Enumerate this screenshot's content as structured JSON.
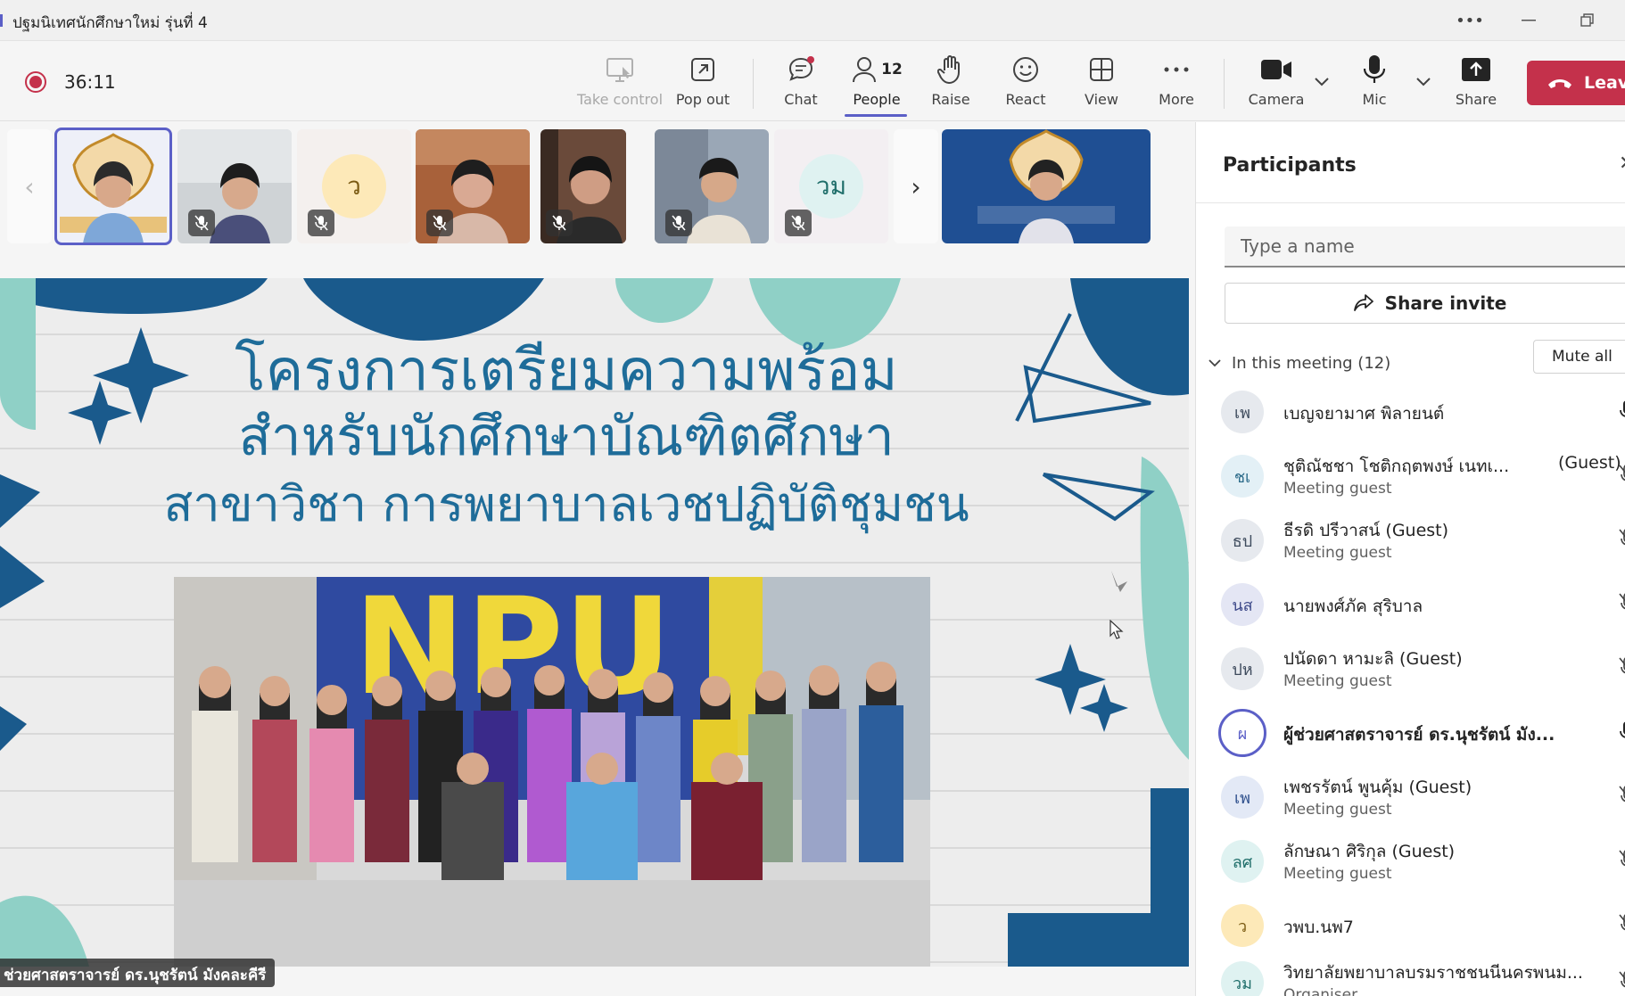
{
  "window": {
    "title": "ปฐมนิเทศนักศึกษาใหม่ รุ่นที่ 4"
  },
  "toolbar": {
    "timer": "36:11",
    "take_control": "Take control",
    "pop_out": "Pop out",
    "chat": "Chat",
    "people": "People",
    "people_count": "12",
    "raise": "Raise",
    "react": "React",
    "view": "View",
    "more": "More",
    "camera": "Camera",
    "mic": "Mic",
    "share": "Share",
    "leave": "Leave"
  },
  "strip": {
    "avatar_initials": [
      "ว",
      "วม"
    ]
  },
  "slide": {
    "line1": "โครงการเตรียมความพร้อม",
    "line2": "สำหรับนักศึกษาบัณฑิตศึกษา",
    "line3": "สาขาวิชา การพยาบาลเวชปฏิบัติชุมชน",
    "photo_banner_text": "NPU",
    "speaker_tag": "ช่วยศาสตราจารย์ ดร.นุชรัตน์ มังคละคีรี"
  },
  "panel": {
    "title": "Participants",
    "search_placeholder": "Type a name",
    "share_invite": "Share invite",
    "section_label": "In this meeting (12)",
    "mute_all": "Mute all",
    "participants": [
      {
        "initials": "เพ",
        "name": "เบญจยามาศ พิลายนต์",
        "sub": "",
        "guest_tag": ""
      },
      {
        "initials": "ชเ",
        "name": "ชุติณัชชา โชติกฤตพงษ์ เนทเ...",
        "sub": "Meeting guest",
        "guest_tag": "(Guest)"
      },
      {
        "initials": "ธป",
        "name": "ธีรดิ ปรีวาสน์ (Guest)",
        "sub": "Meeting guest",
        "guest_tag": ""
      },
      {
        "initials": "นส",
        "name": "นายพงศ์ภัค สุริบาล",
        "sub": "",
        "guest_tag": ""
      },
      {
        "initials": "ปห",
        "name": "ปนัดดา หามะลิ (Guest)",
        "sub": "Meeting guest",
        "guest_tag": ""
      },
      {
        "initials": "ผ",
        "name": "ผู้ช่วยศาสตราจารย์ ดร.นุชรัตน์ มัง...",
        "sub": "",
        "guest_tag": ""
      },
      {
        "initials": "เพ",
        "name": "เพชรรัตน์ พูนคุ้ม (Guest)",
        "sub": "Meeting guest",
        "guest_tag": ""
      },
      {
        "initials": "ลศ",
        "name": "ลักษณา ศิริกุล (Guest)",
        "sub": "Meeting guest",
        "guest_tag": ""
      },
      {
        "initials": "ว",
        "name": "วพบ.นพ7",
        "sub": "",
        "guest_tag": ""
      },
      {
        "initials": "วม",
        "name": "วิทยาลัยพยาบาลบรมราชชนนีนครพนม...",
        "sub": "Organiser",
        "guest_tag": ""
      }
    ]
  },
  "colors": {
    "accent": "#5b5fc7",
    "leave": "#c4314b",
    "slide_title": "#1e6c99"
  }
}
